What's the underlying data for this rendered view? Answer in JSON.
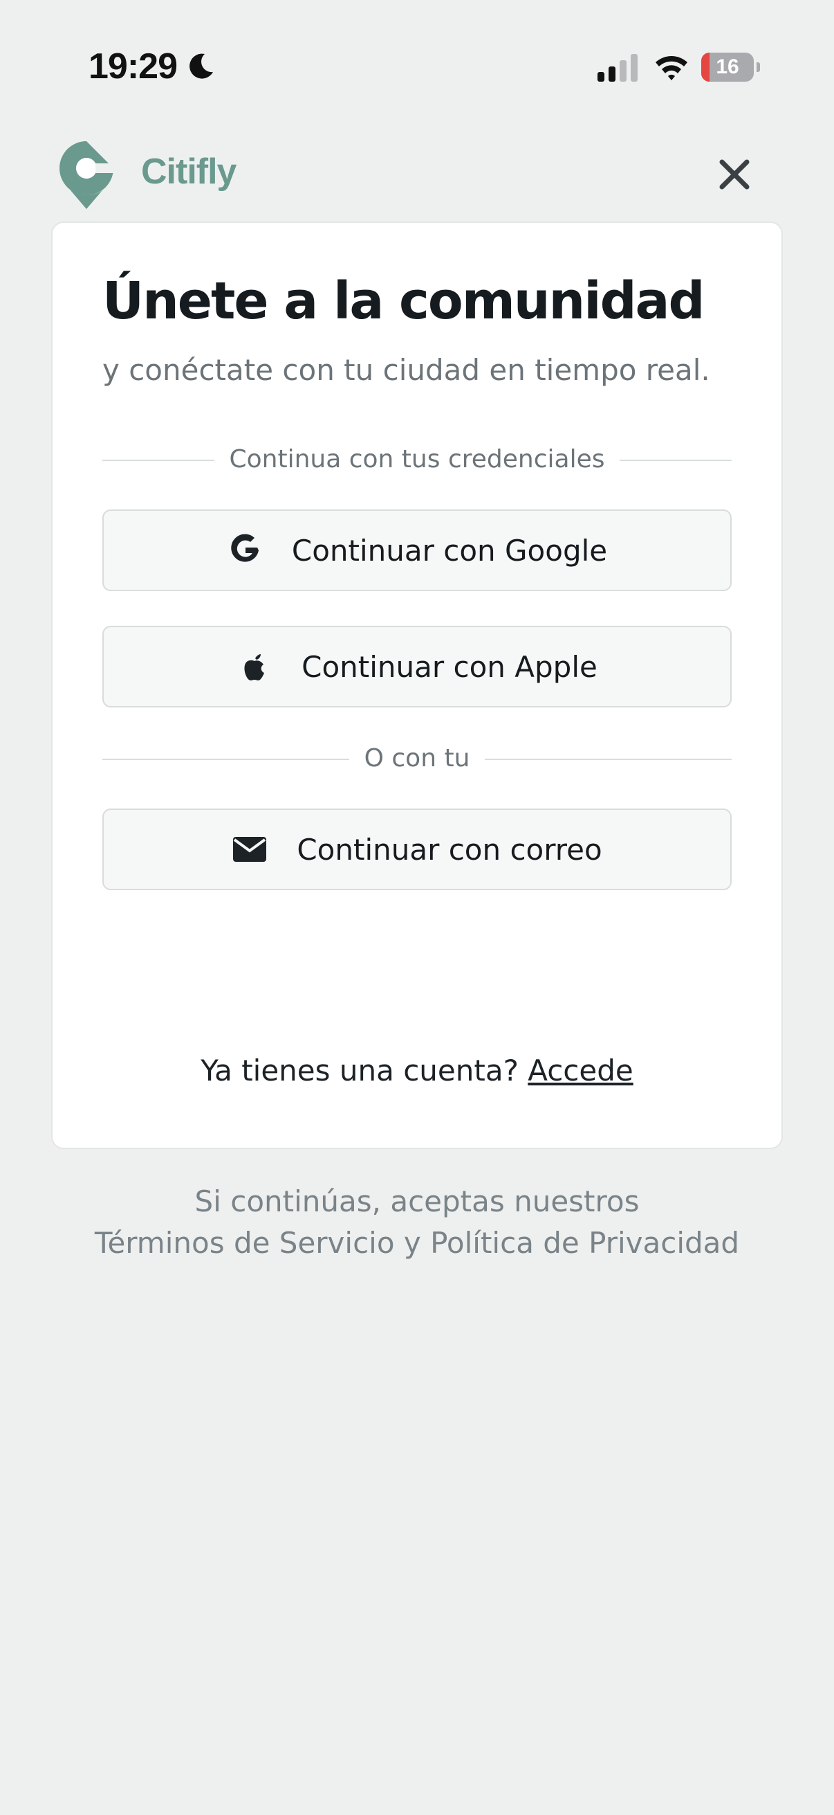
{
  "status_bar": {
    "time": "19:29",
    "battery_level": "16",
    "battery_fraction": 0.16
  },
  "header": {
    "brand": "Citifly",
    "brand_color": "#6a998e",
    "close_icon": "close-icon"
  },
  "card": {
    "title": "Únete a la comunidad",
    "subtitle": "y conéctate con tu ciudad en tiempo real.",
    "divider_credentials": "Continua con tus credenciales",
    "google_button": "Continuar con Google",
    "apple_button": "Continuar con Apple",
    "divider_or": "O con tu",
    "email_button": "Continuar con correo",
    "account_question": "Ya tienes una cuenta?",
    "account_link": "Accede"
  },
  "footer": {
    "line1": "Si continúas, aceptas nuestros",
    "line2": "Términos de Servicio y Política de Privacidad"
  }
}
